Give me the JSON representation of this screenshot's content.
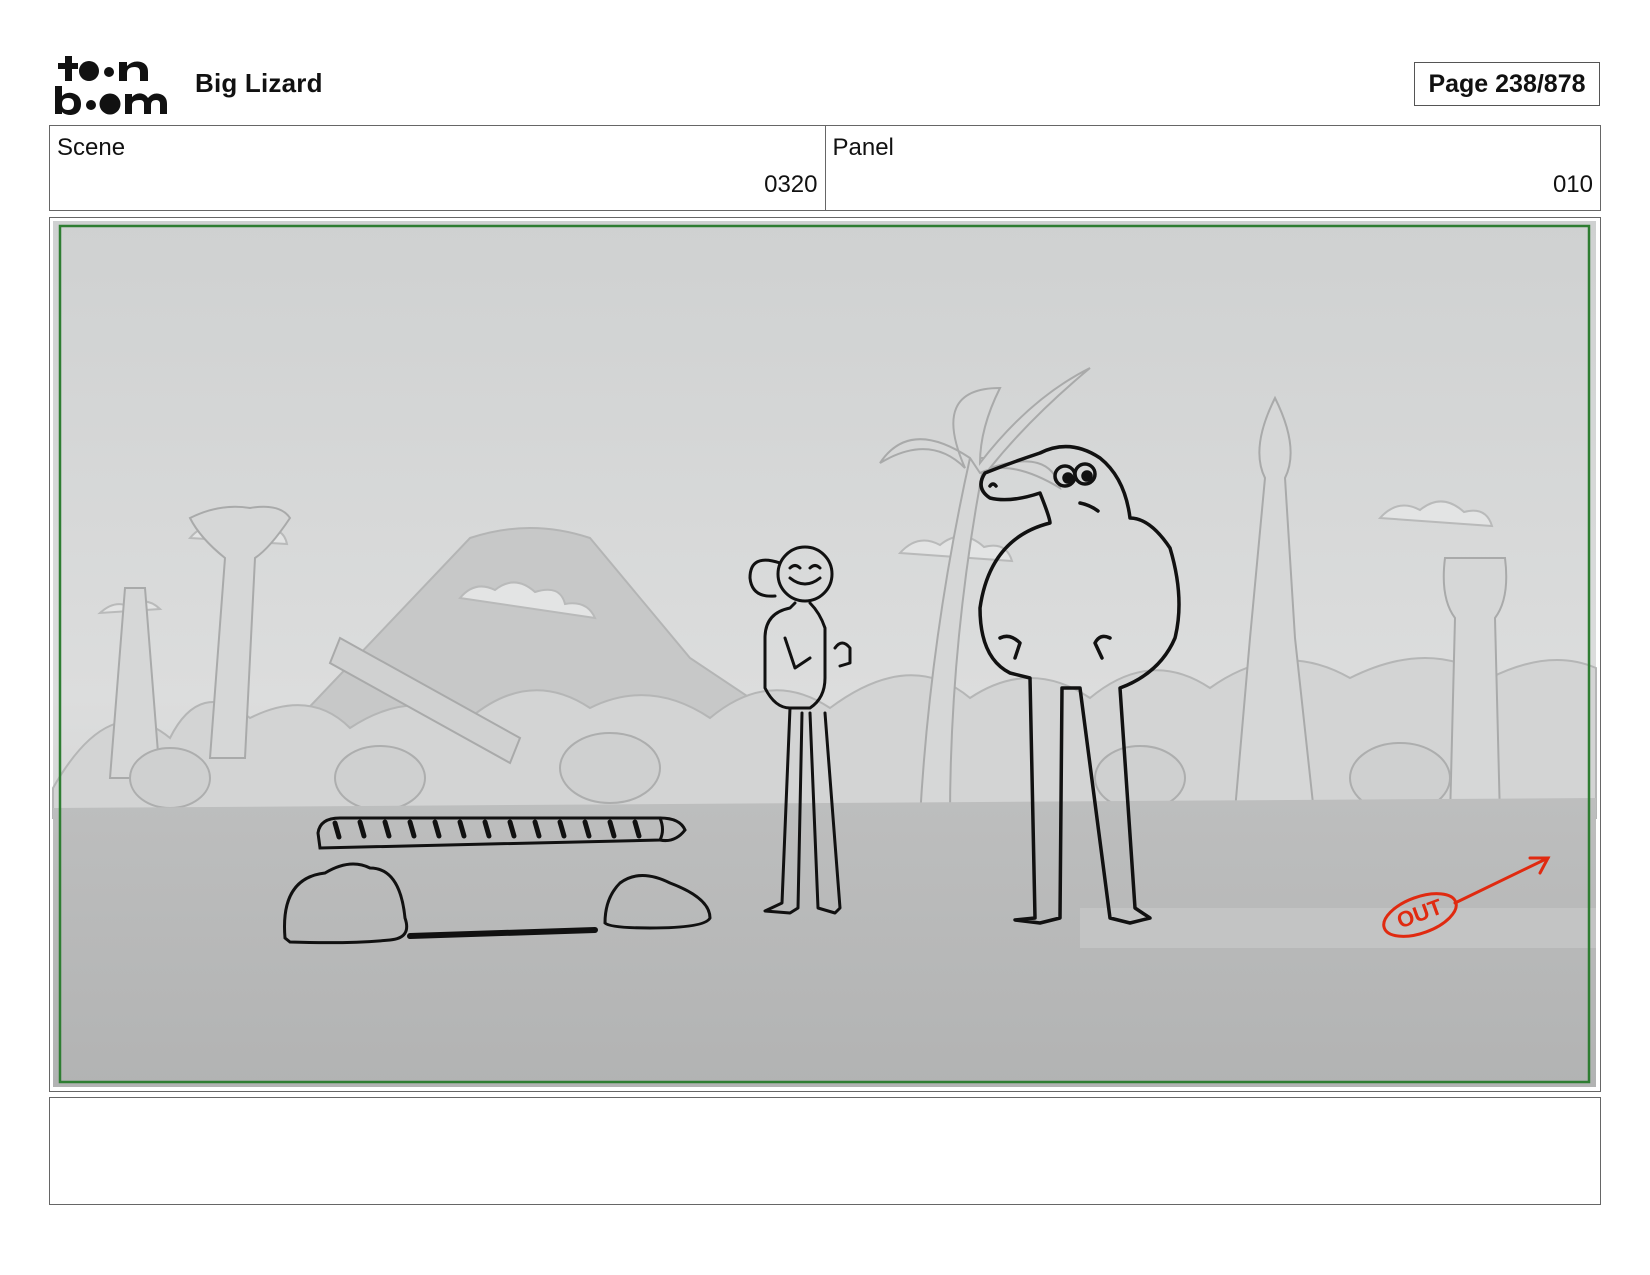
{
  "header": {
    "logo_text": "toon boom",
    "project_title": "Big Lizard",
    "page_label": "Page 238/878"
  },
  "info": {
    "scene_label": "Scene",
    "scene_value": "0320",
    "panel_label": "Panel",
    "panel_value": "010"
  },
  "panel": {
    "annotation_text": "OUT",
    "frame_color": "#2e7d32",
    "annotation_color": "#e02a10"
  },
  "notes": {
    "text": ""
  }
}
